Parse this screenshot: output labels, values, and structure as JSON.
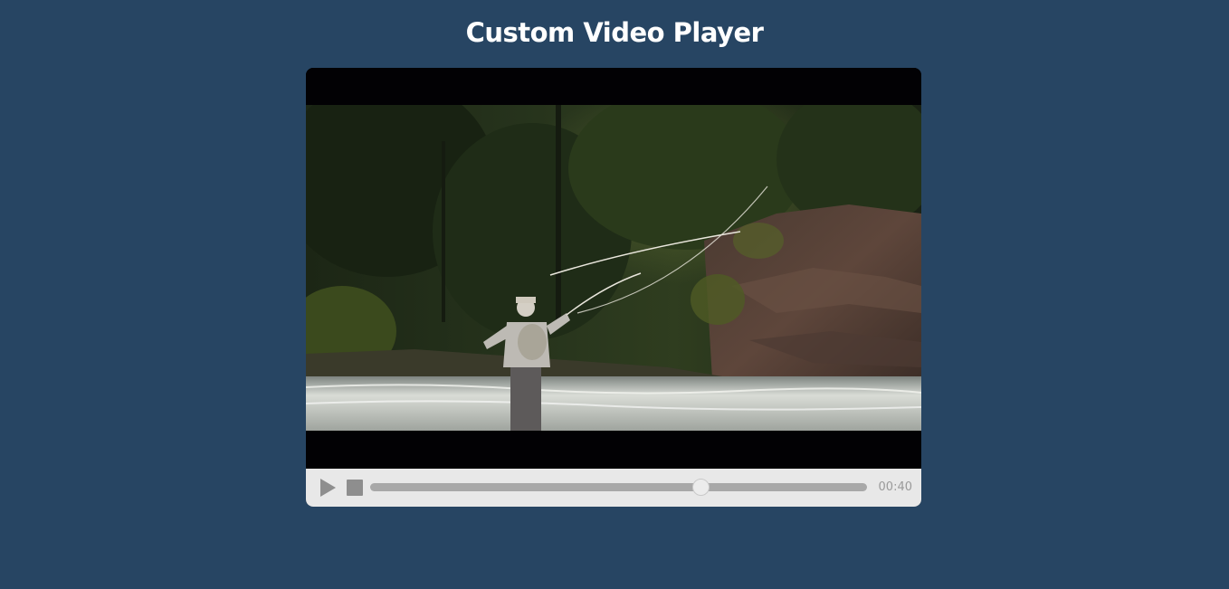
{
  "page": {
    "title": "Custom Video Player"
  },
  "player": {
    "play_icon": "play-icon",
    "stop_icon": "stop-icon",
    "progress_fraction": 0.665,
    "timestamp": "00:40"
  },
  "colors": {
    "background": "#274563",
    "controls_background": "#e8e8e8",
    "control_icon": "#8e8e8e",
    "progress_track": "#a8a8a8",
    "title_text": "#ffffff"
  }
}
